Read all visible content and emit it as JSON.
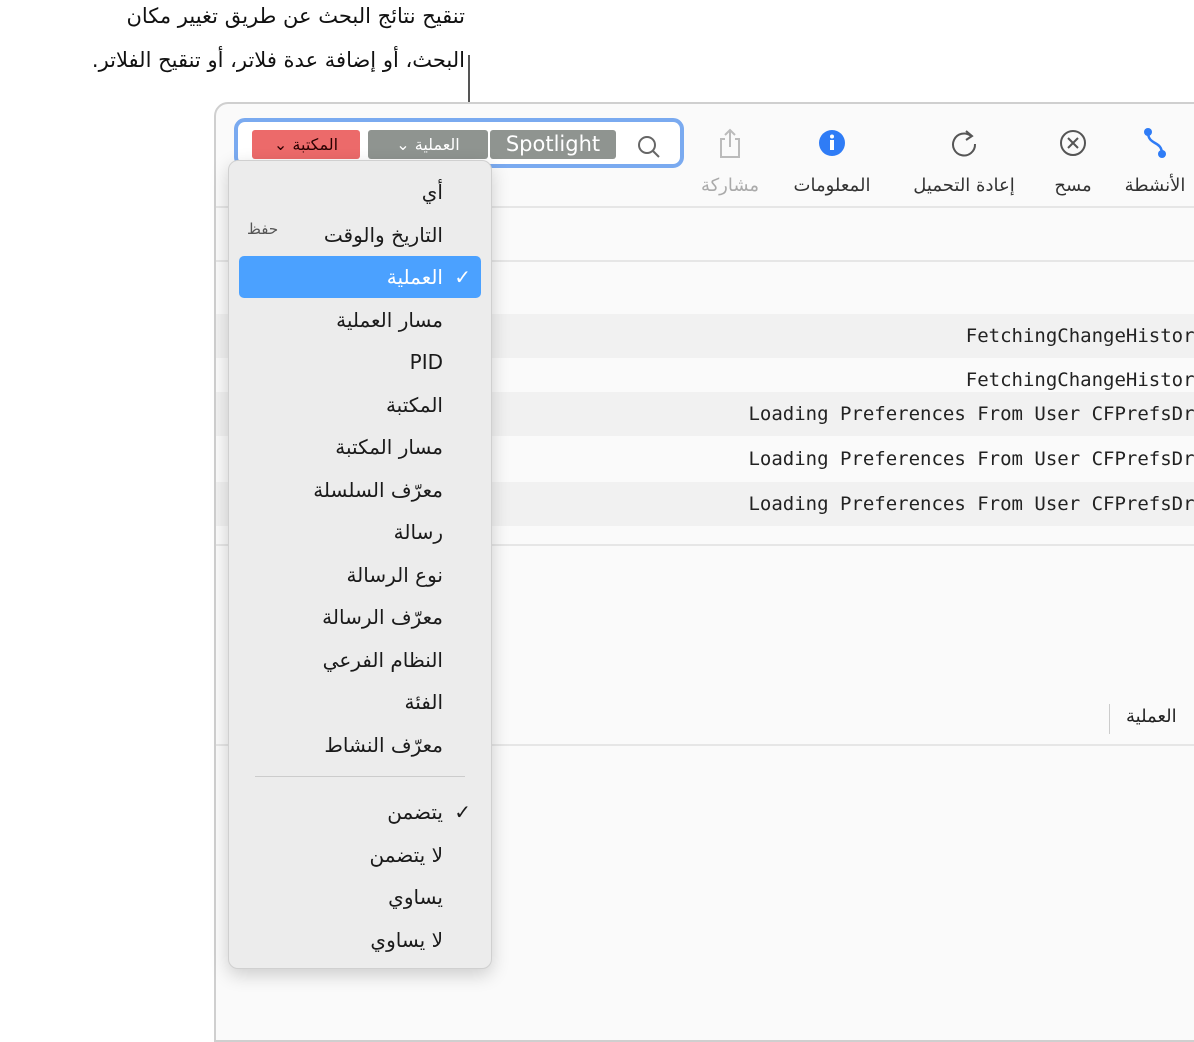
{
  "callout": {
    "line1": "تنقيح نتائج البحث عن طريق تغيير مكان",
    "line2": "البحث، أو إضافة عدة فلاتر، أو تنقيح الفلاتر."
  },
  "search": {
    "tokens": [
      {
        "label": "المكتبة",
        "color": "#ec6a6a"
      },
      {
        "label": "العملية",
        "color": "#8f9490"
      },
      {
        "label": "Spotlight",
        "color": "#8f9490"
      }
    ]
  },
  "toolbar": {
    "items": [
      {
        "label": "الأنشطة",
        "icon": "activities-icon"
      },
      {
        "label": "مسح",
        "icon": "clear-icon"
      },
      {
        "label": "إعادة التحميل",
        "icon": "reload-icon"
      },
      {
        "label": "المعلومات",
        "icon": "info-icon"
      },
      {
        "label": "مشاركة",
        "icon": "share-icon",
        "disabled": true
      }
    ]
  },
  "rows": [
    "FetchingChangeHistory",
    "FetchingChangeHistory",
    "Loading Preferences From User CFPrefsDrP",
    "Loading Preferences From User CFPrefsDrP",
    "Loading Preferences From User CFPrefsDrP"
  ],
  "detail": {
    "label": "العملية"
  },
  "menu": {
    "fields": [
      {
        "label": "أي"
      },
      {
        "label": "التاريخ والوقت",
        "shortcut": "حفظ"
      },
      {
        "label": "العملية",
        "selected": true
      },
      {
        "label": "مسار العملية"
      },
      {
        "label": "PID"
      },
      {
        "label": "المكتبة"
      },
      {
        "label": "مسار المكتبة"
      },
      {
        "label": "معرّف السلسلة"
      },
      {
        "label": "رسالة"
      },
      {
        "label": "نوع الرسالة"
      },
      {
        "label": "معرّف الرسالة"
      },
      {
        "label": "النظام الفرعي"
      },
      {
        "label": "الفئة"
      },
      {
        "label": "معرّف النشاط"
      }
    ],
    "operators": [
      {
        "label": "يتضمن",
        "checked": true
      },
      {
        "label": "لا يتضمن"
      },
      {
        "label": "يساوي"
      },
      {
        "label": "لا يساوي"
      }
    ]
  },
  "colors": {
    "accent": "#4ba1ff",
    "searchBorder": "#7aaaf0",
    "info": "#2f7cf6"
  }
}
